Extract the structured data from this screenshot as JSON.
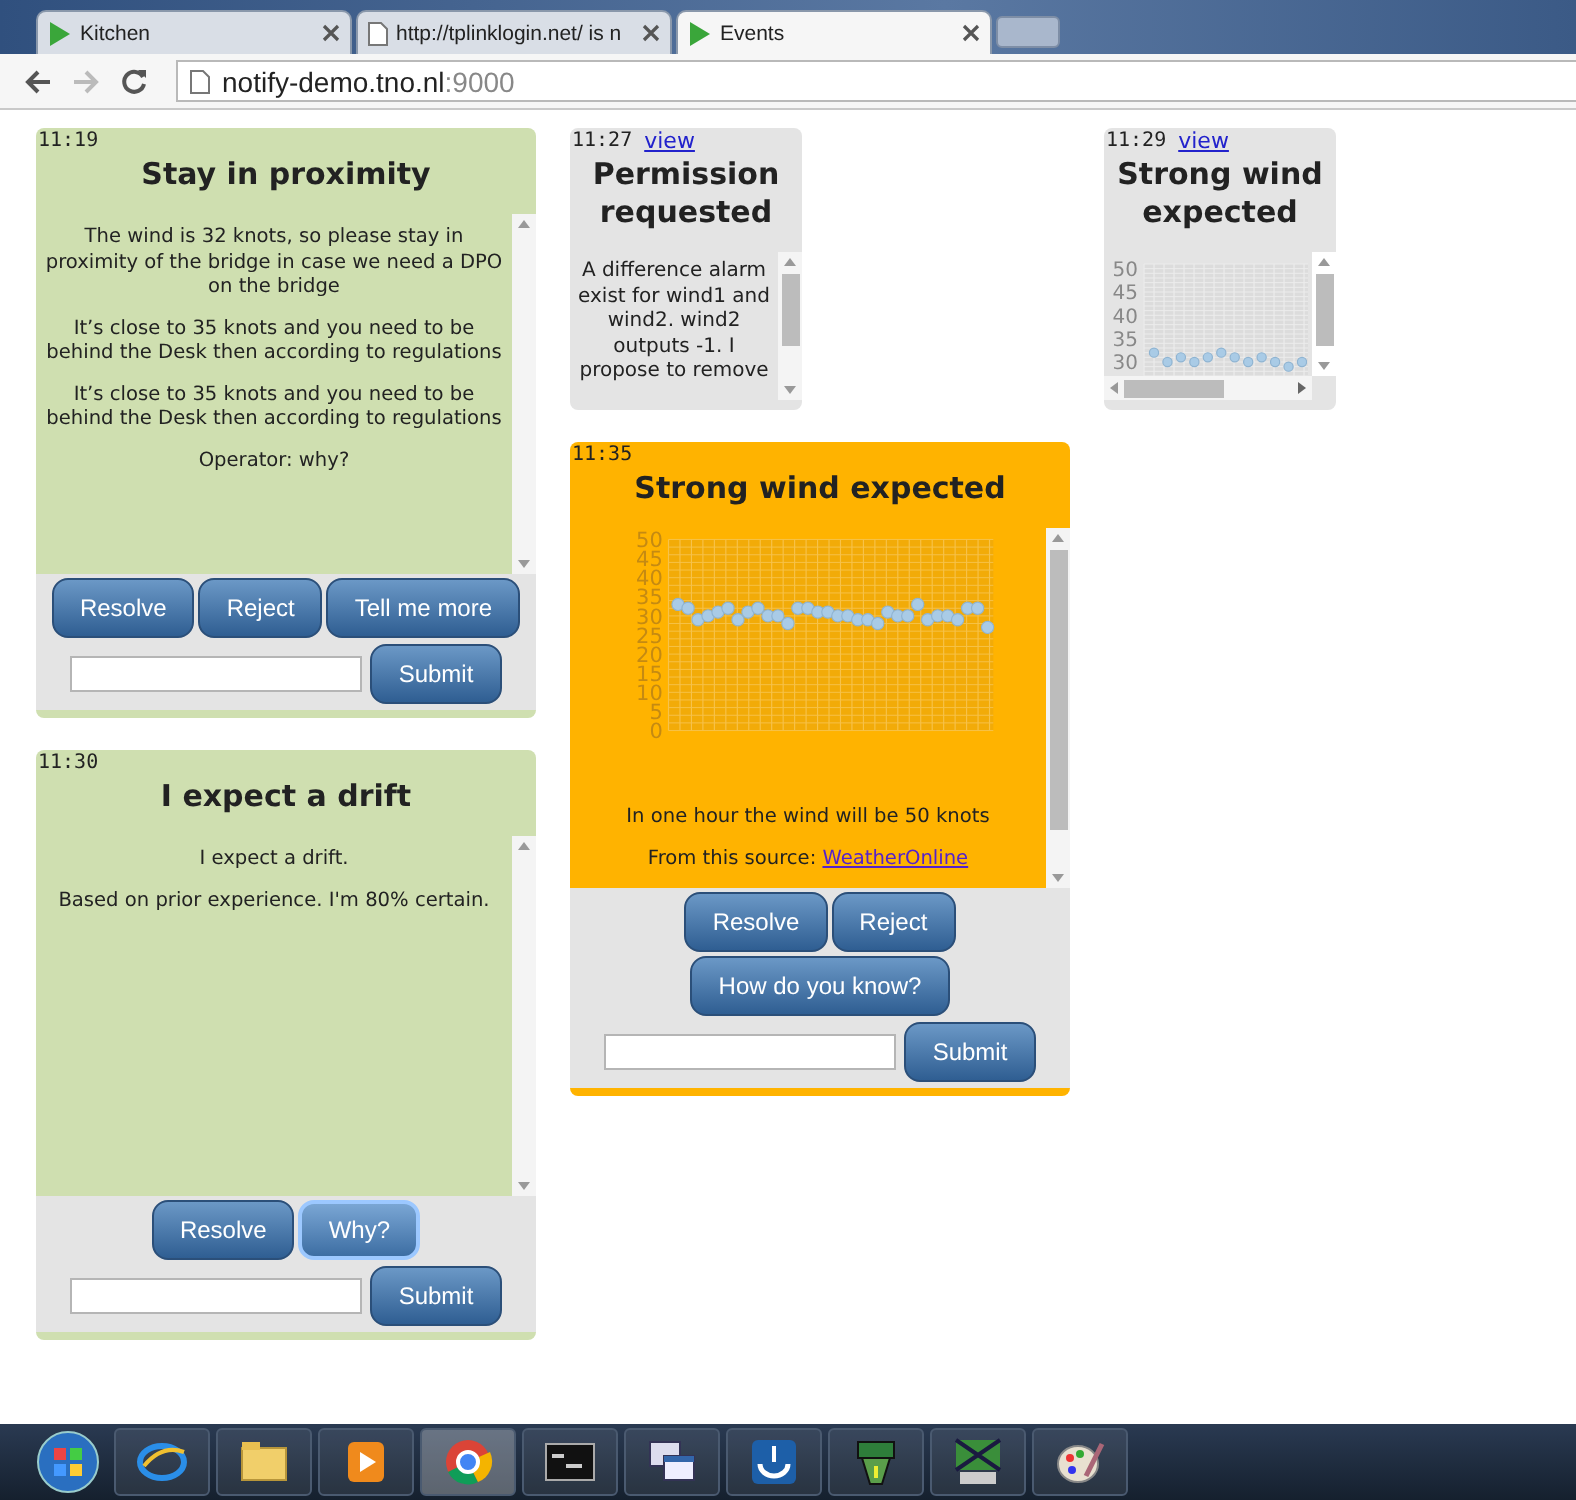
{
  "browser": {
    "tabs": [
      {
        "label": "Kitchen",
        "kind": "app",
        "selected": false
      },
      {
        "label": "http://tplinklogin.net/ is n",
        "kind": "page",
        "selected": false
      },
      {
        "label": "Events",
        "kind": "app",
        "selected": true
      }
    ],
    "back_disabled": false,
    "forward_disabled": true,
    "address": {
      "host": "notify-demo.tno.nl",
      "port": ":9000"
    }
  },
  "columns": [
    {
      "cards": [
        {
          "kind": "full",
          "color": "#cfdfb0",
          "time": "11:19",
          "title": "Stay in proximity",
          "paragraphs": [
            "The wind is 32 knots, so please stay in proximity of the bridge in case we need a DPO on the bridge",
            "It’s close to 35 knots and you need to be behind the Desk then according to regulations",
            "It’s close to 35 knots and you need to be behind the Desk then according to regulations",
            "Operator: why?"
          ],
          "actions": [
            {
              "label": "Resolve",
              "focused": false
            },
            {
              "label": "Reject",
              "focused": false
            },
            {
              "label": "Tell me more",
              "focused": false
            }
          ],
          "submit": "Submit"
        },
        {
          "kind": "full",
          "color": "#cfdfb0",
          "time": "11:30",
          "title": "I expect a drift",
          "paragraphs": [
            "I expect a drift.",
            "Based on prior experience. I'm 80% certain."
          ],
          "actions": [
            {
              "label": "Resolve",
              "focused": false
            },
            {
              "label": "Why?",
              "focused": true
            }
          ],
          "submit": "Submit"
        }
      ]
    },
    {
      "cards": [
        {
          "kind": "compact",
          "color": "#e4e4e4",
          "time": "11:27",
          "link": "view",
          "title": "Permission requested",
          "paragraphs": [
            "A difference alarm exist for wind1 and wind2. wind2 outputs -1. I propose to remove"
          ]
        },
        {
          "kind": "full",
          "color": "#ffb300",
          "time": "11:35",
          "title": "Strong wind expected",
          "chart_data": {
            "type": "scatter",
            "grid": true,
            "ylim": [
              0,
              50
            ],
            "yticks": [
              0,
              5,
              10,
              15,
              20,
              25,
              30,
              35,
              40,
              45,
              50
            ],
            "series": [
              {
                "color": "#a9cbe6",
                "values": [
                  33,
                  32,
                  29,
                  30,
                  31,
                  32,
                  29,
                  31,
                  32,
                  30,
                  30,
                  28,
                  32,
                  32,
                  31,
                  31,
                  30,
                  30,
                  29,
                  29,
                  28,
                  31,
                  30,
                  30,
                  33,
                  29,
                  30,
                  30,
                  29,
                  32,
                  32,
                  27
                ]
              }
            ]
          },
          "paragraphs": [
            "In one hour the wind will be 50 knots"
          ],
          "source": {
            "prefix": "From this source:",
            "link": "WeatherOnline"
          },
          "actions": [
            {
              "label": "Resolve",
              "focused": false
            },
            {
              "label": "Reject",
              "focused": false
            },
            {
              "label": "How do you know?",
              "focused": false
            }
          ],
          "submit": "Submit"
        }
      ]
    },
    {
      "cards": [
        {
          "kind": "compact",
          "color": "#e4e4e4",
          "time": "11:29",
          "link": "view",
          "title": "Strong wind expected",
          "chart_data": {
            "type": "scatter",
            "grid": true,
            "ylim": [
              27,
              51
            ],
            "yticks": [
              30,
              35,
              40,
              45,
              50
            ],
            "series": [
              {
                "color": "#a9cbe6",
                "values": [
                  32,
                  30,
                  31,
                  30,
                  31,
                  32,
                  31,
                  30,
                  31,
                  30,
                  29,
                  30
                ]
              }
            ]
          }
        }
      ]
    }
  ]
}
